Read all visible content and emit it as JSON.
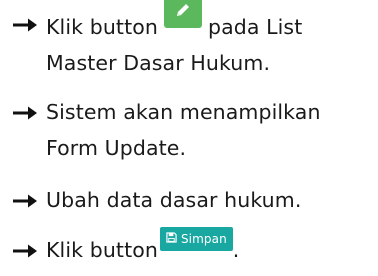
{
  "steps": [
    {
      "text_before": "Klik button",
      "button_icon": "pencil-icon",
      "text_after_line1": "pada List",
      "text_line2": "Master Dasar Hukum."
    },
    {
      "text_line1": "Sistem akan menampilkan",
      "text_line2": "Form Update."
    },
    {
      "text": "Ubah data dasar hukum."
    },
    {
      "text_before": "Klik button",
      "button_label": "Simpan",
      "button_icon": "floppy-disk-icon",
      "text_after": "."
    }
  ],
  "colors": {
    "edit_button": "#5cb85c",
    "save_button": "#19a7a2",
    "text": "#1a1a1a"
  },
  "bullet_icon": "right-arrow-icon"
}
